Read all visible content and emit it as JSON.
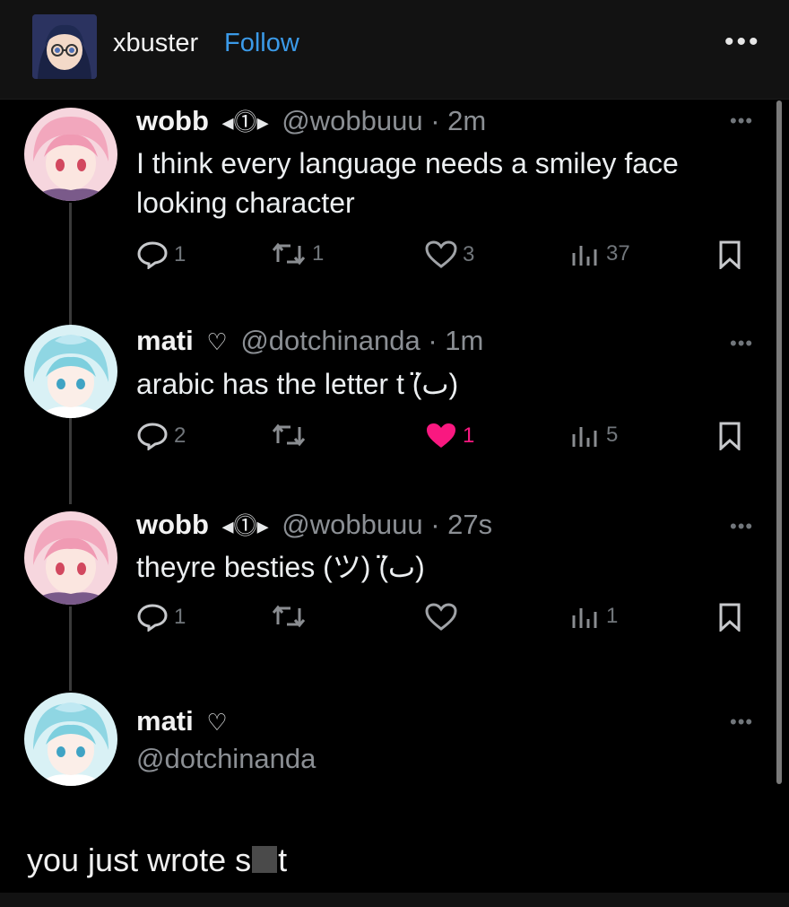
{
  "header": {
    "username": "xbuster",
    "follow_label": "Follow",
    "more_label": "•••"
  },
  "thread": [
    {
      "name": "wobb",
      "badge": "◂⓵▸",
      "handle": "@wobbuuu",
      "time": "· 2m",
      "text": "I think every language needs a smiley face looking character",
      "replies": "1",
      "retweets": "1",
      "likes": "3",
      "views": "37",
      "liked": false
    },
    {
      "name": "mati",
      "badge": "♡",
      "handle": "@dotchinanda",
      "time": "· 1m",
      "text": "arabic has the letter t (ٮ̈)",
      "replies": "2",
      "retweets": "",
      "likes": "1",
      "views": "5",
      "liked": true
    },
    {
      "name": "wobb",
      "badge": "◂⓵▸",
      "handle": "@wobbuuu",
      "time": "· 27s",
      "text": "theyre besties (ツ) (ٮ̈)",
      "replies": "1",
      "retweets": "",
      "likes": "",
      "views": "1",
      "liked": false
    },
    {
      "name": "mati",
      "badge": "♡",
      "handle": "@dotchinanda"
    }
  ],
  "reply_text_before": "you just wrote s",
  "reply_text_after": "t",
  "colors": {
    "accent": "#3b9ae8",
    "like": "#f91880",
    "muted": "#71767b"
  }
}
